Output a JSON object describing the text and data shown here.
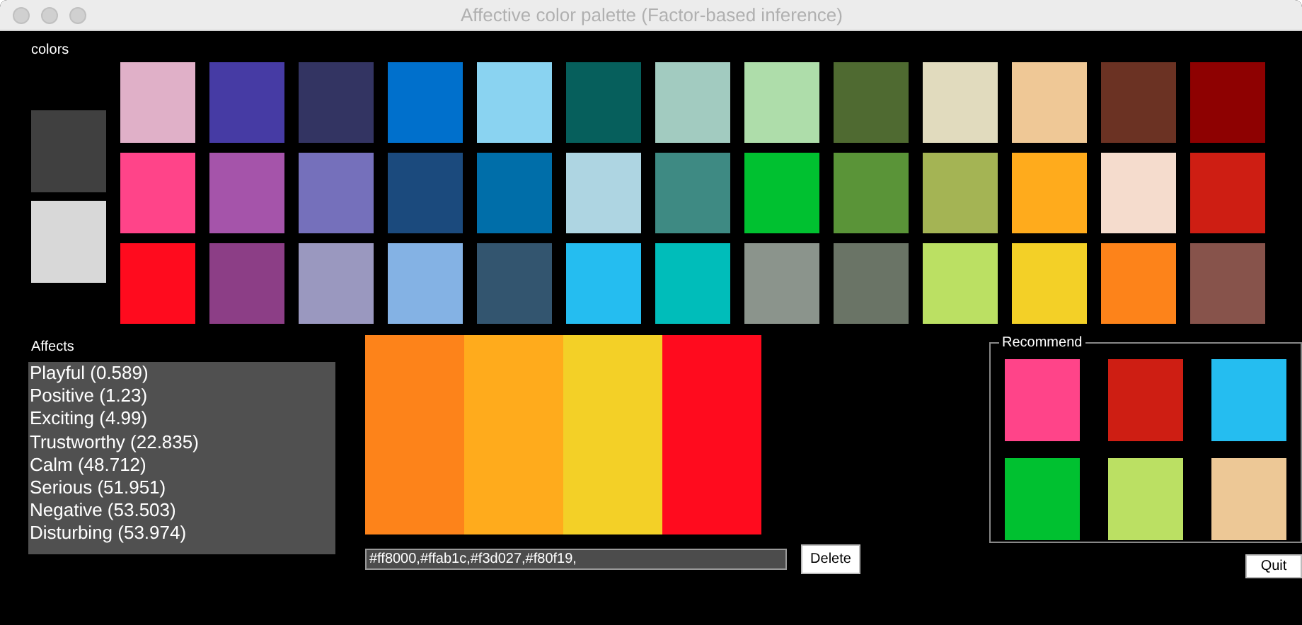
{
  "window": {
    "title": "Affective color palette (Factor-based inference)"
  },
  "colors": {
    "label": "colors",
    "side_swatches": [
      {
        "color": "#404040"
      },
      {
        "color": "#d8d8d8"
      }
    ],
    "grid": [
      {
        "color": "#e0b0c8"
      },
      {
        "color": "#463ba4"
      },
      {
        "color": "#333462"
      },
      {
        "color": "#0070cc"
      },
      {
        "color": "#8ad3f1"
      },
      {
        "color": "#065f5c"
      },
      {
        "color": "#a2cbc0"
      },
      {
        "color": "#aeddaa"
      },
      {
        "color": "#4f6a31"
      },
      {
        "color": "#e1dbbe"
      },
      {
        "color": "#efc896"
      },
      {
        "color": "#6b3223"
      },
      {
        "color": "#8e0101"
      },
      {
        "color": "#ff4489"
      },
      {
        "color": "#a554aa"
      },
      {
        "color": "#7570bb"
      },
      {
        "color": "#1b4a7d"
      },
      {
        "color": "#006ea9"
      },
      {
        "color": "#aed5e2"
      },
      {
        "color": "#3e8a83"
      },
      {
        "color": "#00c130"
      },
      {
        "color": "#5a9438"
      },
      {
        "color": "#a4b454"
      },
      {
        "color": "#ffab1c"
      },
      {
        "color": "#f5dccd"
      },
      {
        "color": "#ce1e13"
      },
      {
        "color": "#ff0b1e"
      },
      {
        "color": "#8c3e86"
      },
      {
        "color": "#9a98bf"
      },
      {
        "color": "#84b2e4"
      },
      {
        "color": "#33556f"
      },
      {
        "color": "#25bdf0"
      },
      {
        "color": "#00bdba"
      },
      {
        "color": "#8b948c"
      },
      {
        "color": "#6a7466"
      },
      {
        "color": "#bbe063"
      },
      {
        "color": "#f3d027"
      },
      {
        "color": "#fd831a"
      },
      {
        "color": "#87534b"
      }
    ]
  },
  "affects": {
    "label": "Affects",
    "items": [
      "Playful (0.589)",
      "Positive (1.23)",
      "Exciting (4.99)",
      "Trustworthy (22.835)",
      "Calm (48.712)",
      "Serious (51.951)",
      "Negative (53.503)",
      "Disturbing (53.974)"
    ]
  },
  "palette": {
    "swatches": [
      {
        "color": "#fd831a"
      },
      {
        "color": "#ffab1c"
      },
      {
        "color": "#f3d027"
      },
      {
        "color": "#ff0b1e"
      }
    ],
    "value": "#ff8000,#ffab1c,#f3d027,#f80f19,",
    "delete_button": "Delete"
  },
  "recommend": {
    "label": "Recommend",
    "swatches": [
      {
        "color": "#ff4489"
      },
      {
        "color": "#ce1e13"
      },
      {
        "color": "#25bdf0"
      },
      {
        "color": "#00c130"
      },
      {
        "color": "#bbe063"
      },
      {
        "color": "#edc896"
      }
    ]
  },
  "quit_button": "Quit"
}
